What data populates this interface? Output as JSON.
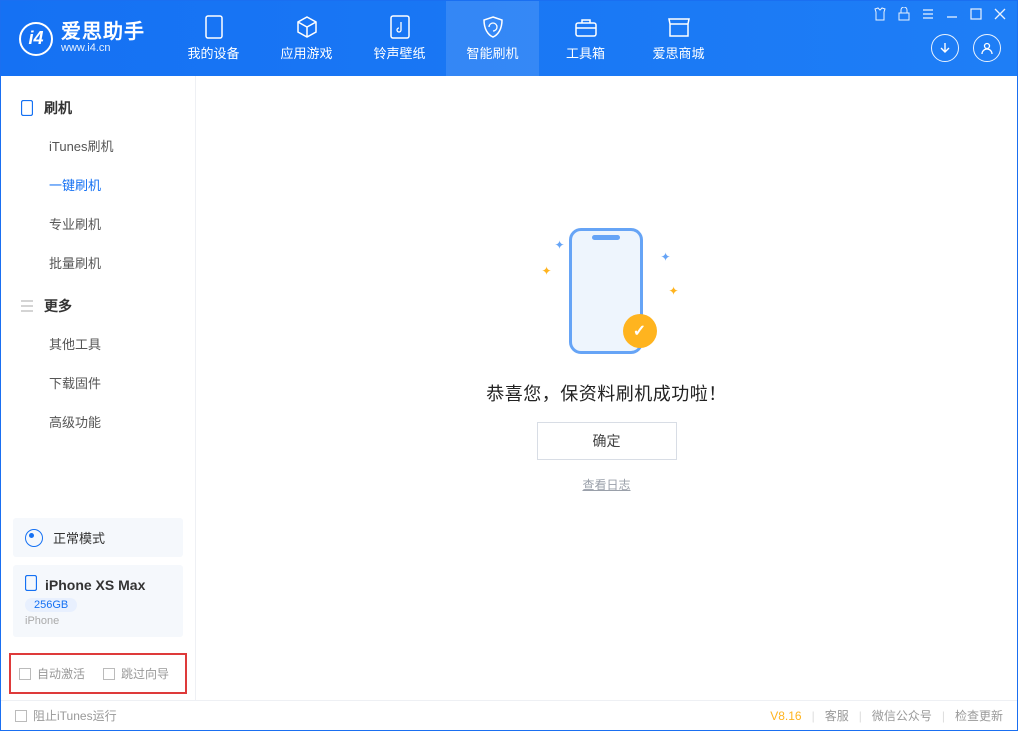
{
  "header": {
    "brand": "爱思助手",
    "url": "www.i4.cn",
    "nav": [
      {
        "label": "我的设备"
      },
      {
        "label": "应用游戏"
      },
      {
        "label": "铃声壁纸"
      },
      {
        "label": "智能刷机",
        "active": true
      },
      {
        "label": "工具箱"
      },
      {
        "label": "爱思商城"
      }
    ]
  },
  "sidebar": {
    "groups": [
      {
        "title": "刷机",
        "items": [
          {
            "label": "iTunes刷机"
          },
          {
            "label": "一键刷机",
            "active": true
          },
          {
            "label": "专业刷机"
          },
          {
            "label": "批量刷机"
          }
        ]
      },
      {
        "title": "更多",
        "items": [
          {
            "label": "其他工具"
          },
          {
            "label": "下载固件"
          },
          {
            "label": "高级功能"
          }
        ]
      }
    ],
    "mode_label": "正常模式",
    "device": {
      "name": "iPhone XS Max",
      "storage": "256GB",
      "type": "iPhone"
    },
    "checks": {
      "auto_activate": "自动激活",
      "skip_guide": "跳过向导"
    }
  },
  "main": {
    "success_msg": "恭喜您，保资料刷机成功啦！",
    "ok_label": "确定",
    "log_link": "查看日志"
  },
  "status": {
    "block_itunes": "阻止iTunes运行",
    "version": "V8.16",
    "links": [
      "客服",
      "微信公众号",
      "检查更新"
    ]
  }
}
